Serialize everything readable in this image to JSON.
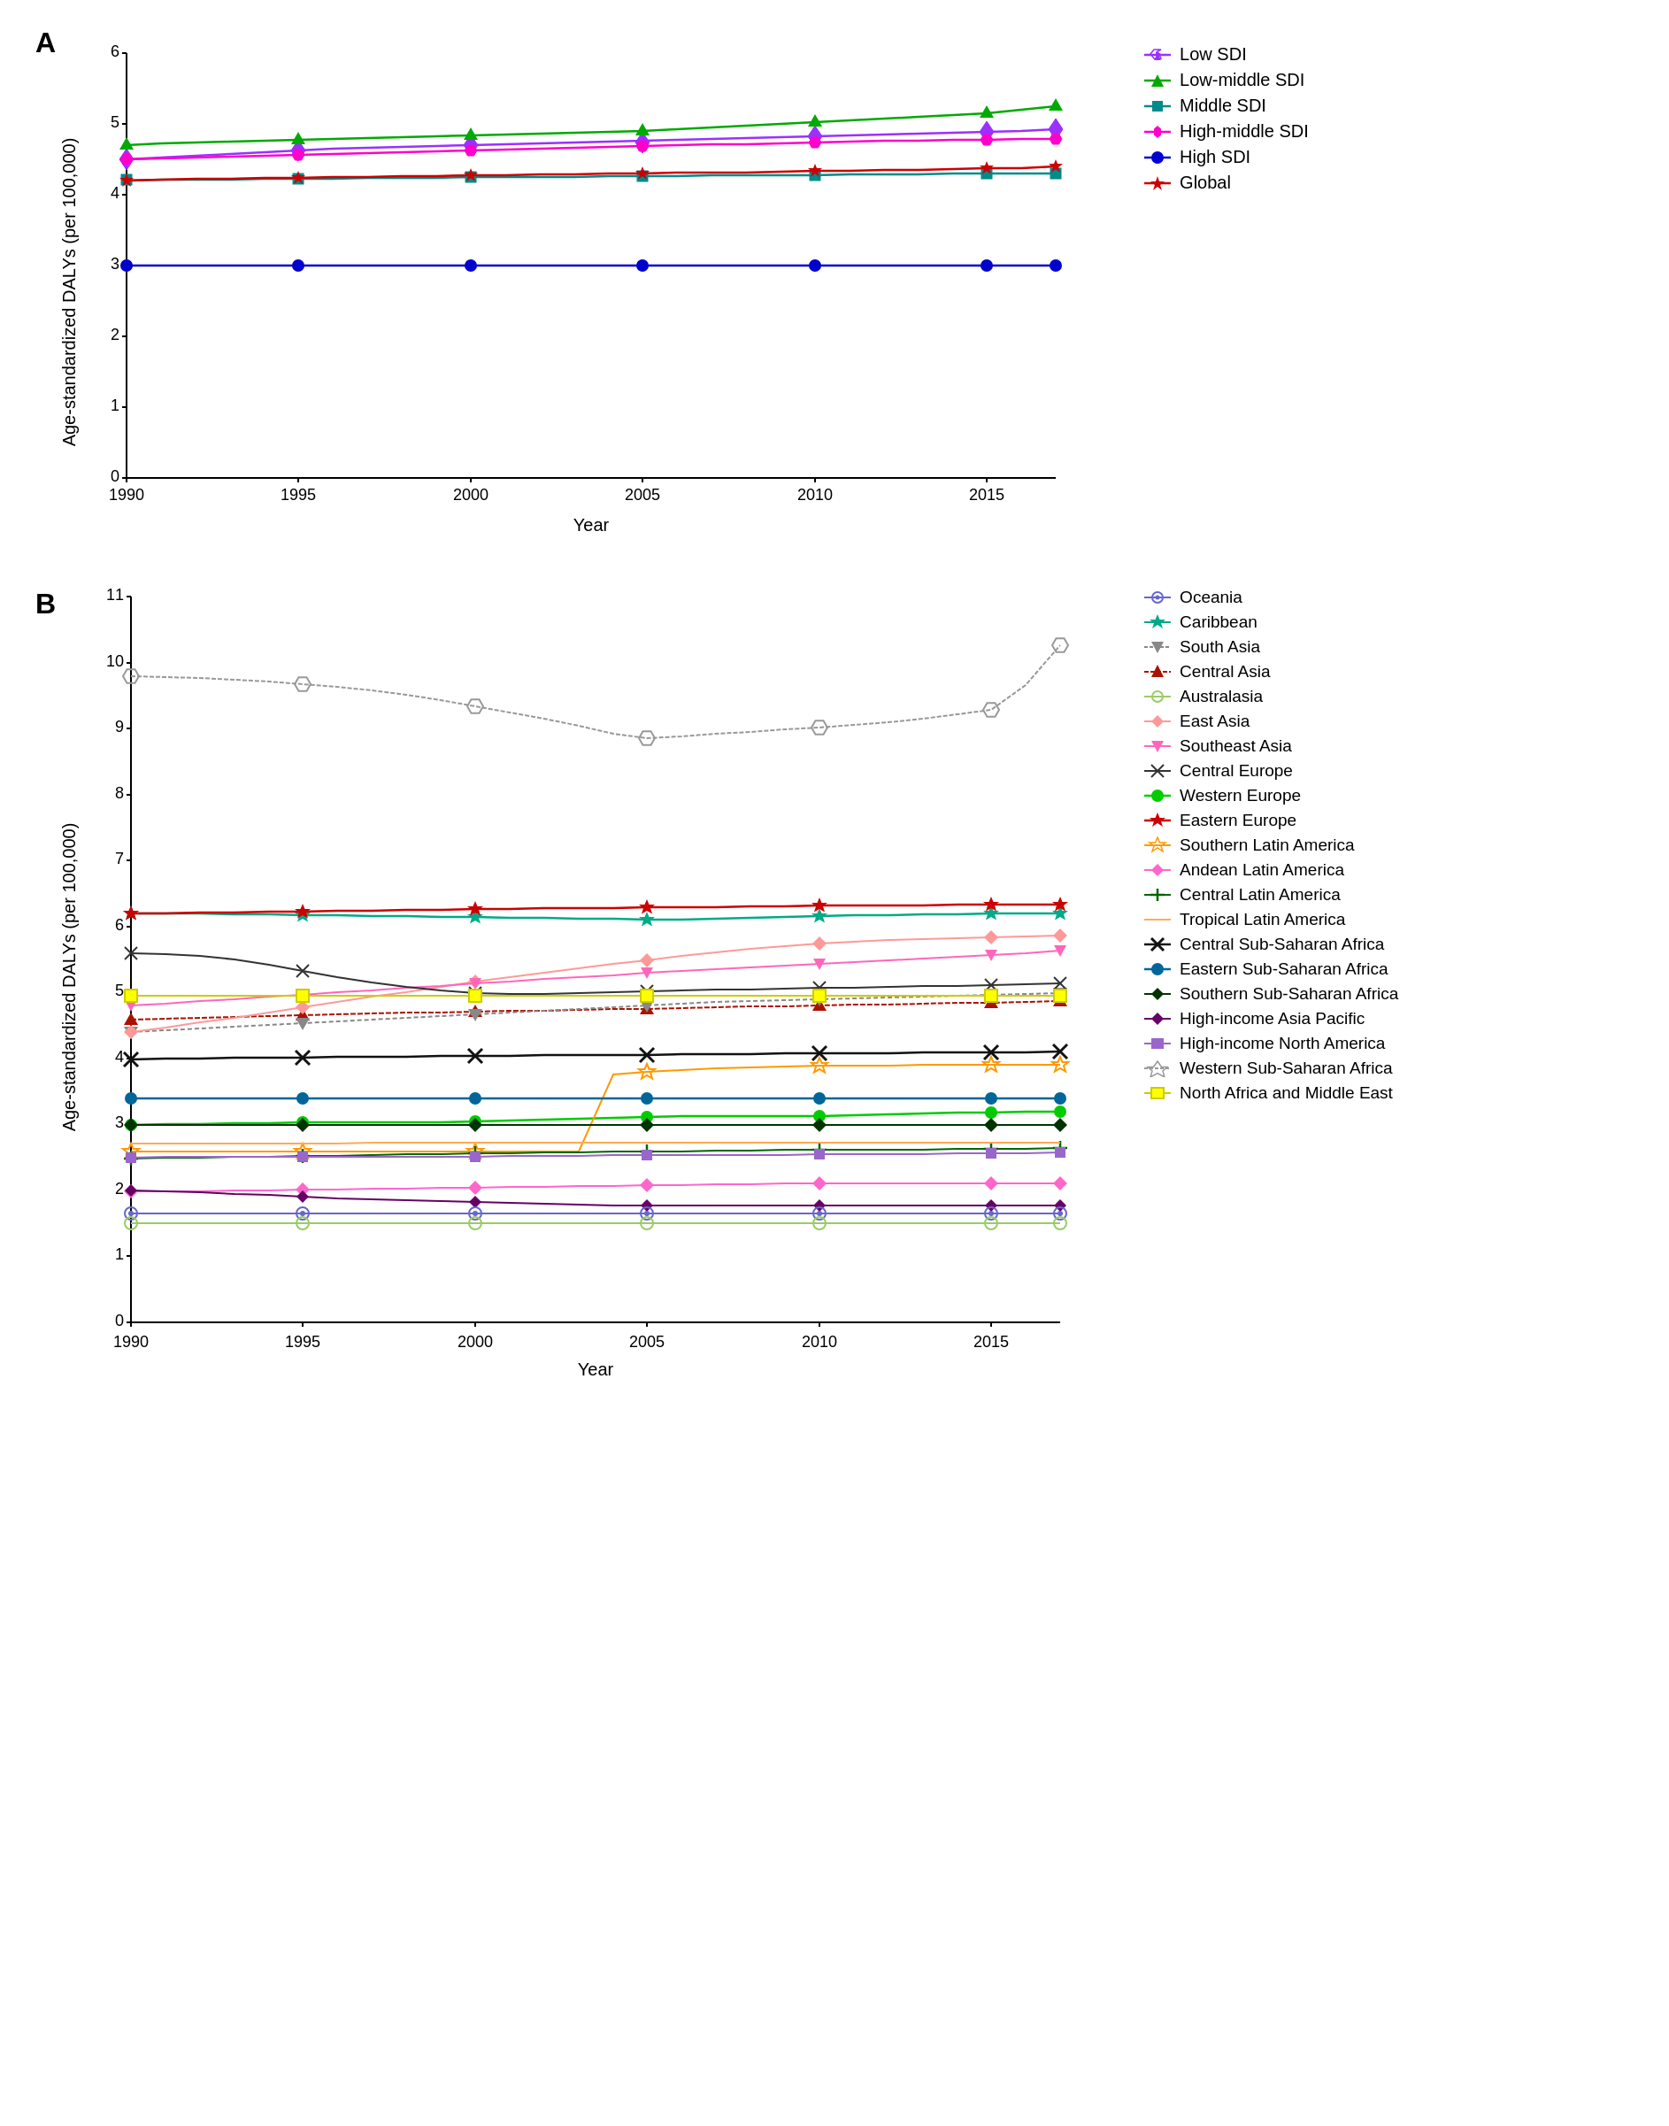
{
  "panels": {
    "A": {
      "label": "A",
      "title": "Age-standardized DALYs (per 100,000)",
      "x_label": "Year",
      "x_min": 1990,
      "x_max": 2017,
      "y_min": 0,
      "y_max": 6,
      "y_ticks": [
        0,
        1,
        2,
        3,
        4,
        5,
        6
      ],
      "x_ticks": [
        1990,
        1995,
        2000,
        2005,
        2010,
        2015
      ],
      "legend": [
        {
          "label": "Low SDI",
          "color": "#9B30FF",
          "shape": "diamond"
        },
        {
          "label": "Low-middle SDI",
          "color": "#00CC00",
          "shape": "triangle"
        },
        {
          "label": "Middle SDI",
          "color": "#008B8B",
          "shape": "square"
        },
        {
          "label": "High-middle SDI",
          "color": "#FF00FF",
          "shape": "hexagon"
        },
        {
          "label": "High SDI",
          "color": "#0000CD",
          "shape": "circle"
        },
        {
          "label": "Global",
          "color": "#CC0000",
          "shape": "star"
        }
      ]
    },
    "B": {
      "label": "B",
      "title": "Age-standardized DALYs (per 100,000)",
      "x_label": "Year",
      "x_min": 1990,
      "x_max": 2017,
      "y_min": 0,
      "y_max": 11,
      "y_ticks": [
        0,
        1,
        2,
        3,
        4,
        5,
        6,
        7,
        8,
        9,
        10,
        11
      ],
      "x_ticks": [
        1990,
        1995,
        2000,
        2005,
        2010,
        2015
      ],
      "legend": [
        {
          "label": "Oceania",
          "color": "#6699FF",
          "shape": "circle"
        },
        {
          "label": "Caribbean",
          "color": "#00CC99",
          "shape": "star"
        },
        {
          "label": "South Asia",
          "color": "#999999",
          "shape": "triangle-down"
        },
        {
          "label": "Central Asia",
          "color": "#CC2200",
          "shape": "triangle"
        },
        {
          "label": "Australasia",
          "color": "#99CC66",
          "shape": "circle-open"
        },
        {
          "label": "East Asia",
          "color": "#FF9999",
          "shape": "diamond"
        },
        {
          "label": "Southeast Asia",
          "color": "#FF66CC",
          "shape": "triangle-down"
        },
        {
          "label": "Central Europe",
          "color": "#666666",
          "shape": "cross-x"
        },
        {
          "label": "Western Europe",
          "color": "#00CC00",
          "shape": "circle-solid"
        },
        {
          "label": "Eastern Europe",
          "color": "#CC0000",
          "shape": "star"
        },
        {
          "label": "Southern Latin America",
          "color": "#FF9900",
          "shape": "star-open"
        },
        {
          "label": "Andean Latin America",
          "color": "#FF66CC",
          "shape": "diamond"
        },
        {
          "label": "Central Latin America",
          "color": "#006600",
          "shape": "plus"
        },
        {
          "label": "Tropical Latin America",
          "color": "#FFAA66",
          "shape": "line"
        },
        {
          "label": "Central Sub-Saharan Africa",
          "color": "#333333",
          "shape": "cross-x-bold"
        },
        {
          "label": "Eastern Sub-Saharan Africa",
          "color": "#006699",
          "shape": "circle"
        },
        {
          "label": "Southern Sub-Saharan Africa",
          "color": "#004400",
          "shape": "diamond"
        },
        {
          "label": "High-income Asia Pacific",
          "color": "#660066",
          "shape": "diamond"
        },
        {
          "label": "High-income North America",
          "color": "#9966CC",
          "shape": "square"
        },
        {
          "label": "Western Sub-Saharan Africa",
          "color": "#AAAAAA",
          "shape": "circle-open-large"
        },
        {
          "label": "North Africa and Middle East",
          "color": "#CCCC00",
          "shape": "square-open"
        }
      ]
    }
  }
}
